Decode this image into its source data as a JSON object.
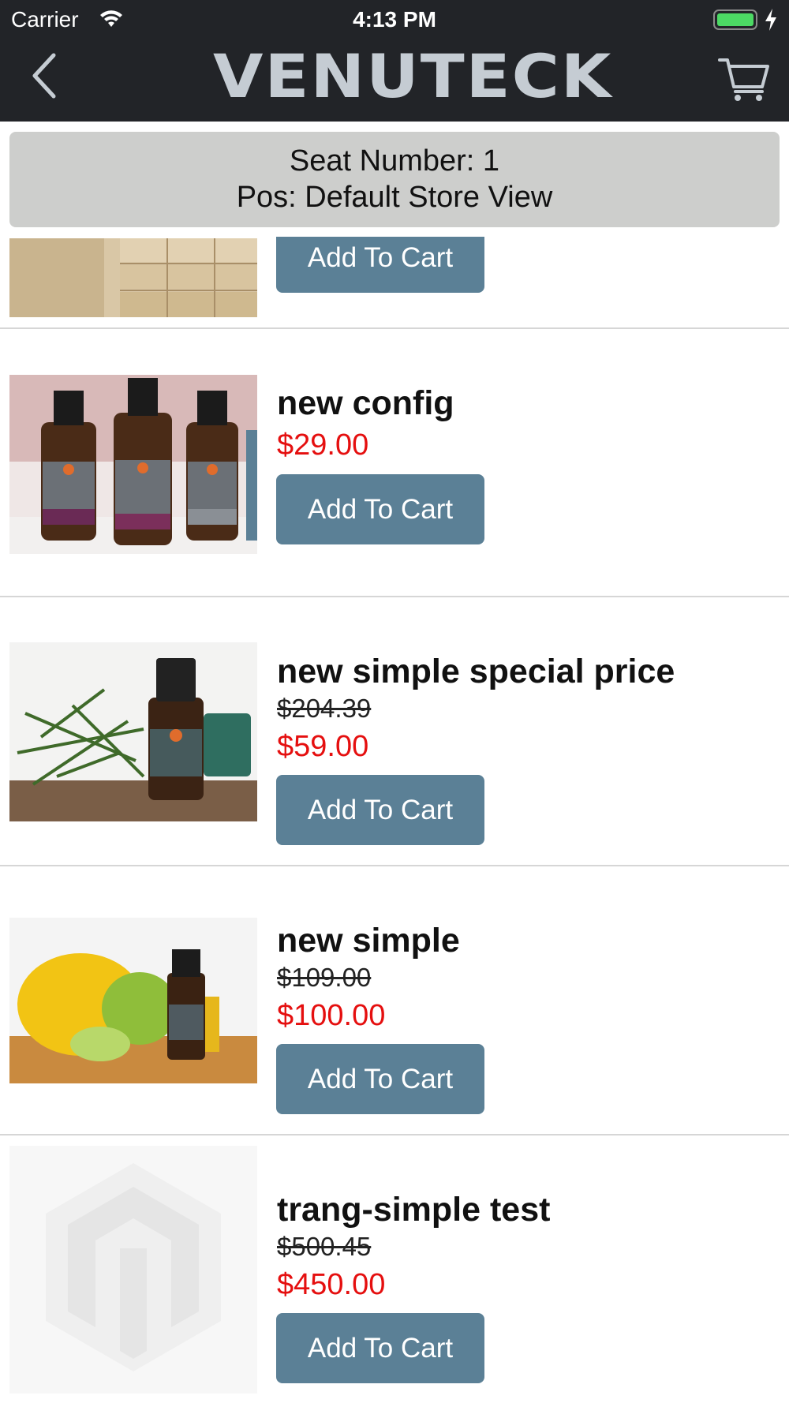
{
  "status_bar": {
    "carrier": "Carrier",
    "time": "4:13 PM",
    "battery_color": "#4cd964"
  },
  "header": {
    "brand": "VENUTECK",
    "back_icon": "chevron-left-icon",
    "cart_icon": "shopping-cart-icon",
    "background_color": "#222428"
  },
  "seat_info": {
    "seat_line": "Seat Number: 1",
    "pos_line": "Pos: Default Store View"
  },
  "products": [
    {
      "name": "",
      "old_price": "",
      "price": "",
      "button_label": "Add To Cart",
      "image": "wood-blocks-photo"
    },
    {
      "name": "new config",
      "old_price": "",
      "price": "$29.00",
      "button_label": "Add To Cart",
      "image": "soil-oil-bottles-photo"
    },
    {
      "name": "new simple special price",
      "old_price": "$204.39",
      "price": "$59.00",
      "button_label": "Add To Cart",
      "image": "rosemary-oil-photo"
    },
    {
      "name": "new simple",
      "old_price": "$109.00",
      "price": "$100.00",
      "button_label": "Add To Cart",
      "image": "lemon-oil-photo"
    },
    {
      "name": "trang-simple test",
      "old_price": "$500.45",
      "price": "$450.00",
      "button_label": "Add To Cart",
      "image": "placeholder-logo"
    }
  ],
  "colors": {
    "accent_button": "#5b8096",
    "price": "#e50f0f",
    "banner": "#cdcecc"
  }
}
